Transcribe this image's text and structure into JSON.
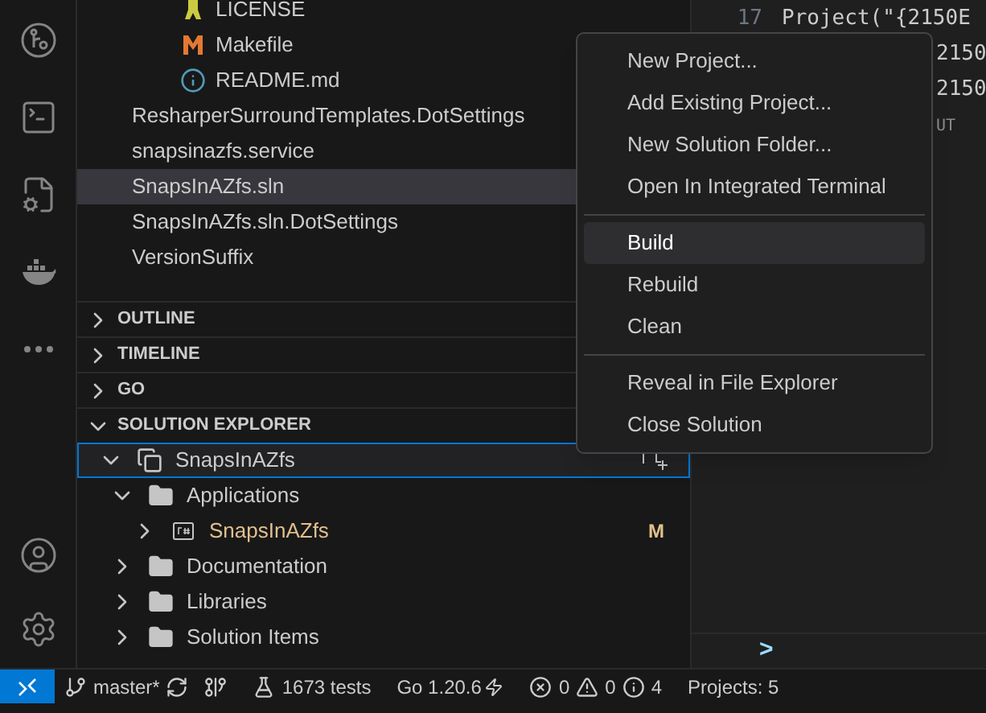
{
  "activity_bar": {
    "items": [
      {
        "kind": "git-graph"
      },
      {
        "kind": "terminal"
      },
      {
        "kind": "cpp"
      },
      {
        "kind": "docker"
      },
      {
        "kind": "more"
      }
    ],
    "bottom": [
      {
        "kind": "account"
      },
      {
        "kind": "settings"
      }
    ]
  },
  "file_tree": [
    {
      "name": "LICENSE",
      "kind": "license",
      "hovered": false
    },
    {
      "name": "Makefile",
      "kind": "makefile",
      "hovered": false
    },
    {
      "name": "README.md",
      "kind": "info",
      "hovered": false
    },
    {
      "name": "ResharperSurroundTemplates.DotSettings",
      "hovered": false
    },
    {
      "name": "snapsinazfs.service",
      "hovered": false
    },
    {
      "name": "SnapsInAZfs.sln",
      "hovered": true
    },
    {
      "name": "SnapsInAZfs.sln.DotSettings",
      "hovered": false
    },
    {
      "name": "VersionSuffix",
      "hovered": false
    }
  ],
  "sections": [
    {
      "title": "OUTLINE",
      "expanded": false
    },
    {
      "title": "TIMELINE",
      "expanded": false
    },
    {
      "title": "GO",
      "expanded": false
    },
    {
      "title": "SOLUTION EXPLORER",
      "expanded": true
    }
  ],
  "solution_explorer": {
    "root": {
      "name": "SnapsInAZfs",
      "expanded": true,
      "selected": true
    },
    "children": [
      {
        "name": "Applications",
        "kind": "folder",
        "expanded": true,
        "children": [
          {
            "name": "SnapsInAZfs",
            "kind": "csproj",
            "expanded": false,
            "badge": "M",
            "modified": true
          }
        ]
      },
      {
        "name": "Documentation",
        "kind": "folder",
        "expanded": false
      },
      {
        "name": "Libraries",
        "kind": "folder",
        "expanded": false
      },
      {
        "name": "Solution Items",
        "kind": "folder",
        "expanded": false
      }
    ]
  },
  "editor": {
    "lines": [
      {
        "number": "17",
        "code": "Project(\"{2150E"
      },
      {
        "code": "2150"
      },
      {
        "code": "2150"
      },
      {
        "code": "UT"
      }
    ]
  },
  "context_menu": {
    "groups": [
      [
        {
          "label": "New Project...",
          "selected": false
        },
        {
          "label": "Add Existing Project...",
          "selected": false
        },
        {
          "label": "New Solution Folder...",
          "selected": false
        },
        {
          "label": "Open In Integrated Terminal",
          "selected": false
        }
      ],
      [
        {
          "label": "Build",
          "selected": true
        },
        {
          "label": "Rebuild",
          "selected": false
        },
        {
          "label": "Clean",
          "selected": false
        }
      ],
      [
        {
          "label": "Reveal in File Explorer",
          "selected": false
        },
        {
          "label": "Close Solution",
          "selected": false
        }
      ]
    ]
  },
  "panel": {
    "prompt": ">"
  },
  "status_bar": {
    "branch": "master*",
    "tests": "1673 tests",
    "go_version": "Go 1.20.6",
    "errors": "0",
    "warnings": "0",
    "infos": "4",
    "projects": "Projects: 5"
  }
}
